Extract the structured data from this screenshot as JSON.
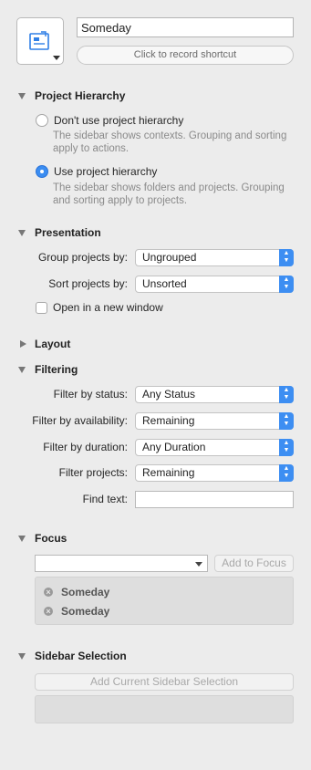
{
  "header": {
    "name_value": "Someday",
    "shortcut_label": "Click to record shortcut"
  },
  "project_hierarchy": {
    "title": "Project Hierarchy",
    "options": [
      {
        "label": "Don't use project hierarchy",
        "hint": "The sidebar shows contexts. Grouping and sorting apply to actions.",
        "selected": false
      },
      {
        "label": "Use project hierarchy",
        "hint": "The sidebar shows folders and projects. Grouping and sorting apply to projects.",
        "selected": true
      }
    ]
  },
  "presentation": {
    "title": "Presentation",
    "group_label": "Group projects by:",
    "group_value": "Ungrouped",
    "sort_label": "Sort projects by:",
    "sort_value": "Unsorted",
    "new_window_label": "Open in a new window"
  },
  "layout": {
    "title": "Layout"
  },
  "filtering": {
    "title": "Filtering",
    "status_label": "Filter by status:",
    "status_value": "Any Status",
    "availability_label": "Filter by availability:",
    "availability_value": "Remaining",
    "duration_label": "Filter by duration:",
    "duration_value": "Any Duration",
    "projects_label": "Filter projects:",
    "projects_value": "Remaining",
    "find_label": "Find text:",
    "find_value": ""
  },
  "focus": {
    "title": "Focus",
    "add_button": "Add to Focus",
    "items": [
      "Someday",
      "Someday"
    ]
  },
  "sidebar_selection": {
    "title": "Sidebar Selection",
    "add_button": "Add Current Sidebar Selection"
  },
  "colors": {
    "accent": "#3d8ef2",
    "background": "#ececec"
  }
}
